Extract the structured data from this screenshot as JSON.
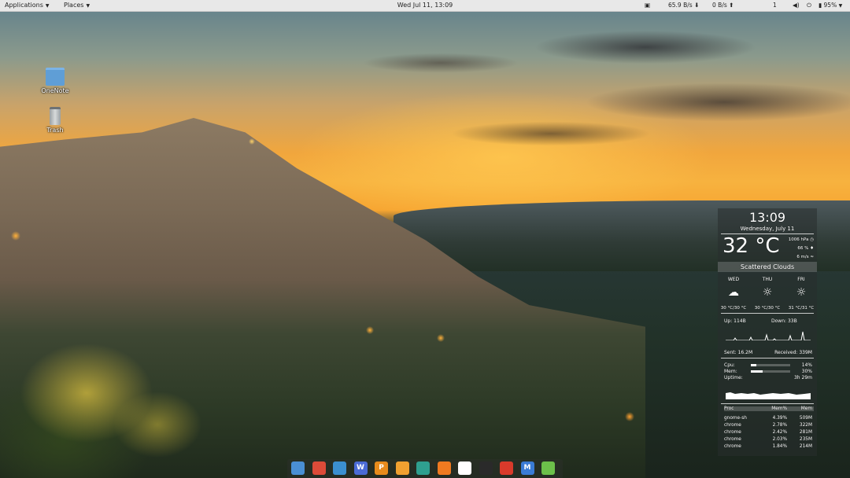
{
  "topbar": {
    "applications_label": "Applications",
    "places_label": "Places",
    "datetime": "Wed Jul 11, 13:09",
    "tray": {
      "net_down": "65.9",
      "net_down_unit": "B/s",
      "net_up": "0",
      "net_up_unit": "B/s",
      "notification_count": "1",
      "battery_percent": "95%"
    }
  },
  "desktop_icons": [
    {
      "label": "OneNote",
      "icon": "folder-icon"
    },
    {
      "label": "Trash",
      "icon": "trash-icon"
    }
  ],
  "widget": {
    "time": "13:09",
    "date": "Wednesday, July 11",
    "temperature": "32 °C",
    "pressure": "1006 hPa",
    "humidity": "66 %",
    "wind": "6 m/s",
    "condition": "Scattered Clouds",
    "forecast": [
      {
        "day": "WED",
        "range": "30 °C/30 °C",
        "icon": "cloud-icon"
      },
      {
        "day": "THU",
        "range": "30 °C/30 °C",
        "icon": "sun-icon"
      },
      {
        "day": "FRI",
        "range": "31 °C/31 °C",
        "icon": "sun-icon"
      }
    ],
    "net": {
      "up_label": "Up:",
      "up_value": "114B",
      "down_label": "Down:",
      "down_value": "33B",
      "sent_label": "Sent:",
      "sent_value": "16.2M",
      "received_label": "Received:",
      "received_value": "339M"
    },
    "system": {
      "cpu_label": "Cpu:",
      "cpu_value": "14%",
      "cpu_fraction": 0.14,
      "mem_label": "Mem:",
      "mem_value": "30%",
      "mem_fraction": 0.3,
      "uptime_label": "Uptime:",
      "uptime_value": "3h 29m"
    },
    "processes": {
      "headers": [
        "Proc",
        "Mem%",
        "Mem"
      ],
      "rows": [
        [
          "gnome-sh",
          "4.39%",
          "509M"
        ],
        [
          "chrome",
          "2.78%",
          "322M"
        ],
        [
          "chrome",
          "2.42%",
          "281M"
        ],
        [
          "chrome",
          "2.03%",
          "235M"
        ],
        [
          "chrome",
          "1.84%",
          "214M"
        ]
      ]
    }
  },
  "dock": {
    "items": [
      {
        "name": "files-icon",
        "color": "#4a8fd4",
        "glyph": ""
      },
      {
        "name": "chrome-icon",
        "color": "#dd4b39",
        "glyph": ""
      },
      {
        "name": "sync-icon",
        "color": "#3b8fd0",
        "glyph": ""
      },
      {
        "name": "writer-icon",
        "color": "#4b6bd6",
        "glyph": "W"
      },
      {
        "name": "presentation-icon",
        "color": "#e88b1c",
        "glyph": "P"
      },
      {
        "name": "screenshot-icon",
        "color": "#f0a030",
        "glyph": ""
      },
      {
        "name": "user-icon",
        "color": "#2f9f8f",
        "glyph": ""
      },
      {
        "name": "slides-icon",
        "color": "#f07a20",
        "glyph": ""
      },
      {
        "name": "soccer-ball-icon",
        "color": "#ffffff",
        "glyph": ""
      },
      {
        "name": "inkscape-icon",
        "color": "#2a2a2a",
        "glyph": ""
      },
      {
        "name": "foxit-icon",
        "color": "#d93a2b",
        "glyph": ""
      },
      {
        "name": "mailspring-icon",
        "color": "#3a7bd5",
        "glyph": "M"
      },
      {
        "name": "notes-icon",
        "color": "#6cc04a",
        "glyph": ""
      }
    ]
  }
}
